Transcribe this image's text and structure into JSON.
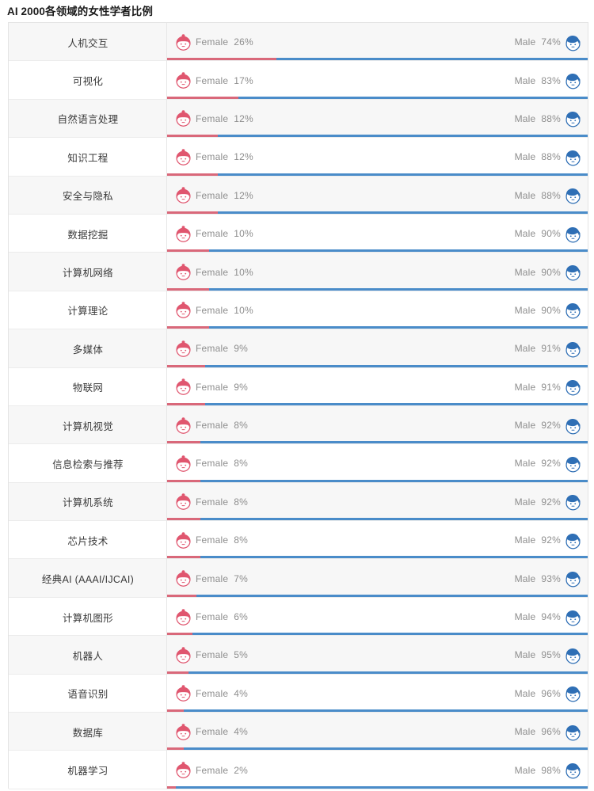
{
  "title": "AI 2000各领域的女性学者比例",
  "legend": {
    "female_label": "Female",
    "male_label": "Male",
    "female_icon": "female-avatar-icon",
    "male_icon": "male-avatar-icon"
  },
  "colors": {
    "female_bar": "#d9687a",
    "male_bar": "#4a8cc9",
    "female_hair": "#e0566f",
    "male_hair": "#2f6fb5",
    "text": "#8e8e8e",
    "label_text": "#3a3a3a",
    "row_alt": "#f7f7f7",
    "border": "#e3e3e3"
  },
  "chart_data": {
    "type": "bar",
    "title": "AI 2000各领域的女性学者比例",
    "xlabel": "",
    "ylabel": "",
    "xlim": [
      0,
      100
    ],
    "grid": false,
    "legend_position": "inline-row",
    "stacked": true,
    "orientation": "horizontal",
    "unit": "%",
    "categories": [
      "人机交互",
      "可视化",
      "自然语言处理",
      "知识工程",
      "安全与隐私",
      "数据挖掘",
      "计算机网络",
      "计算理论",
      "多媒体",
      "物联网",
      "计算机视觉",
      "信息检索与推荐",
      "计算机系统",
      "芯片技术",
      "经典AI (AAAI/IJCAI)",
      "计算机图形",
      "机器人",
      "语音识别",
      "数据库",
      "机器学习"
    ],
    "series": [
      {
        "name": "Female",
        "color": "#d9687a",
        "values": [
          26,
          17,
          12,
          12,
          12,
          10,
          10,
          10,
          9,
          9,
          8,
          8,
          8,
          8,
          7,
          6,
          5,
          4,
          4,
          2
        ]
      },
      {
        "name": "Male",
        "color": "#4a8cc9",
        "values": [
          74,
          83,
          88,
          88,
          88,
          90,
          90,
          90,
          91,
          91,
          92,
          92,
          92,
          92,
          93,
          94,
          95,
          96,
          96,
          98
        ]
      }
    ]
  },
  "rows": [
    {
      "label": "人机交互",
      "female": 26,
      "male": 74,
      "female_text": "26%",
      "male_text": "74%"
    },
    {
      "label": "可视化",
      "female": 17,
      "male": 83,
      "female_text": "17%",
      "male_text": "83%"
    },
    {
      "label": "自然语言处理",
      "female": 12,
      "male": 88,
      "female_text": "12%",
      "male_text": "88%"
    },
    {
      "label": "知识工程",
      "female": 12,
      "male": 88,
      "female_text": "12%",
      "male_text": "88%"
    },
    {
      "label": "安全与隐私",
      "female": 12,
      "male": 88,
      "female_text": "12%",
      "male_text": "88%"
    },
    {
      "label": "数据挖掘",
      "female": 10,
      "male": 90,
      "female_text": "10%",
      "male_text": "90%"
    },
    {
      "label": "计算机网络",
      "female": 10,
      "male": 90,
      "female_text": "10%",
      "male_text": "90%"
    },
    {
      "label": "计算理论",
      "female": 10,
      "male": 90,
      "female_text": "10%",
      "male_text": "90%"
    },
    {
      "label": "多媒体",
      "female": 9,
      "male": 91,
      "female_text": "9%",
      "male_text": "91%"
    },
    {
      "label": "物联网",
      "female": 9,
      "male": 91,
      "female_text": "9%",
      "male_text": "91%"
    },
    {
      "label": "计算机视觉",
      "female": 8,
      "male": 92,
      "female_text": "8%",
      "male_text": "92%"
    },
    {
      "label": "信息检索与推荐",
      "female": 8,
      "male": 92,
      "female_text": "8%",
      "male_text": "92%"
    },
    {
      "label": "计算机系统",
      "female": 8,
      "male": 92,
      "female_text": "8%",
      "male_text": "92%"
    },
    {
      "label": "芯片技术",
      "female": 8,
      "male": 92,
      "female_text": "8%",
      "male_text": "92%"
    },
    {
      "label": "经典AI (AAAI/IJCAI)",
      "female": 7,
      "male": 93,
      "female_text": "7%",
      "male_text": "93%"
    },
    {
      "label": "计算机图形",
      "female": 6,
      "male": 94,
      "female_text": "6%",
      "male_text": "94%"
    },
    {
      "label": "机器人",
      "female": 5,
      "male": 95,
      "female_text": "5%",
      "male_text": "95%"
    },
    {
      "label": "语音识别",
      "female": 4,
      "male": 96,
      "female_text": "4%",
      "male_text": "96%"
    },
    {
      "label": "数据库",
      "female": 4,
      "male": 96,
      "female_text": "4%",
      "male_text": "96%"
    },
    {
      "label": "机器学习",
      "female": 2,
      "male": 98,
      "female_text": "2%",
      "male_text": "98%"
    }
  ]
}
